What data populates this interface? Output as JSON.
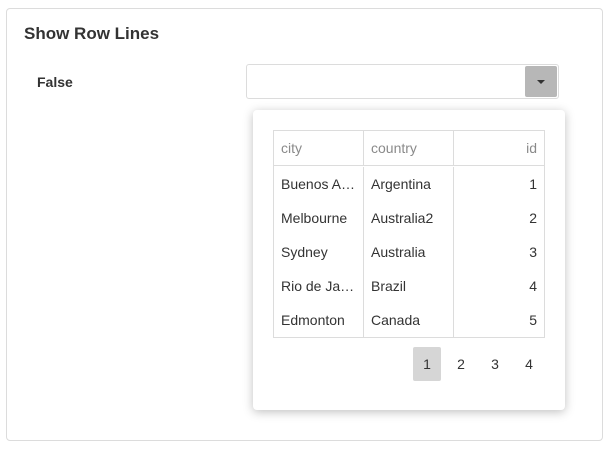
{
  "card": {
    "title": "Show Row Lines"
  },
  "setting": {
    "label": "False",
    "value": ""
  },
  "grid": {
    "columns": [
      "city",
      "country",
      "id"
    ],
    "rows": [
      {
        "city": "Buenos Aires",
        "country": "Argentina",
        "id": "1"
      },
      {
        "city": "Melbourne",
        "country": "Australia2",
        "id": "2"
      },
      {
        "city": "Sydney",
        "country": "Australia",
        "id": "3"
      },
      {
        "city": "Rio de Janeiro",
        "country": "Brazil",
        "id": "4"
      },
      {
        "city": "Edmonton",
        "country": "Canada",
        "id": "5"
      }
    ]
  },
  "pager": {
    "pages": [
      "1",
      "2",
      "3",
      "4"
    ],
    "active_page": "1"
  },
  "icons": {
    "dropdown": "chevron-down-icon"
  }
}
